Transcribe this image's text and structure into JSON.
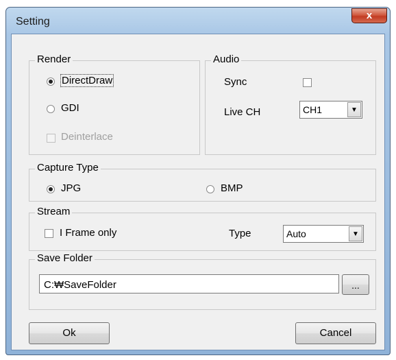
{
  "window": {
    "title": "Setting",
    "close_glyph": "x"
  },
  "render": {
    "label": "Render",
    "options": [
      {
        "label": "DirectDraw",
        "checked": true
      },
      {
        "label": "GDI",
        "checked": false
      }
    ],
    "deinterlace": {
      "label": "Deinterlace",
      "checked": false,
      "enabled": false
    }
  },
  "audio": {
    "label": "Audio",
    "sync_label": "Sync",
    "sync_checked": false,
    "live_ch_label": "Live CH",
    "live_ch_value": "CH1"
  },
  "capture": {
    "label": "Capture Type",
    "options": [
      {
        "label": "JPG",
        "checked": true
      },
      {
        "label": "BMP",
        "checked": false
      }
    ]
  },
  "stream": {
    "label": "Stream",
    "iframe_label": "I Frame only",
    "iframe_checked": false,
    "type_label": "Type",
    "type_value": "Auto"
  },
  "save_folder": {
    "label": "Save Folder",
    "path": "C:₩SaveFolder",
    "browse_label": "..."
  },
  "buttons": {
    "ok": "Ok",
    "cancel": "Cancel"
  },
  "icons": {
    "dropdown": "chevron-down-icon",
    "close": "close-icon"
  }
}
